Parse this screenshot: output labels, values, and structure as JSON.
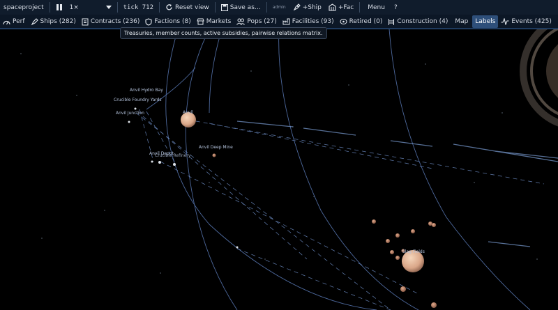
{
  "toolbar": {
    "app_name": "spaceproject",
    "speed": "1×",
    "tick": "tick 712",
    "reset_view": "Reset view",
    "save_as": "Save as…",
    "admin": "admin",
    "add_ship": "+Ship",
    "add_fac": "+Fac",
    "menu": "Menu",
    "help": "?"
  },
  "tabs": [
    {
      "label": "Perf"
    },
    {
      "label": "Ships (282)"
    },
    {
      "label": "Contracts (236)"
    },
    {
      "label": "Factions (8)"
    },
    {
      "label": "Markets"
    },
    {
      "label": "Pops (27)"
    },
    {
      "label": "Facilities (93)"
    },
    {
      "label": "Retired (0)"
    },
    {
      "label": "Construction (4)"
    },
    {
      "label": "Map"
    },
    {
      "label": "Labels"
    },
    {
      "label": "Events (425)"
    }
  ],
  "tooltip": "Treasuries, member counts, active subsidies, pairwise relations matrix.",
  "map_labels": {
    "anvil_hydro_bay": "Anvil Hydro Bay",
    "crucible_foundry": "Crucible Foundry Yards",
    "anvil_junction": "Anvil Junction",
    "anvil": "Anvil",
    "anvil_deep_mine": "Anvil Deep Mine",
    "anvil_depot": "Anvil Depot",
    "overlap": "Crucible Refinery",
    "slag_fields": "Slag Fields"
  },
  "icons": {
    "pause": "pause-icon",
    "dropdown": "chevron-down-icon",
    "reset": "refresh-icon",
    "save": "save-icon",
    "ship": "rocket-icon",
    "fac": "building-icon",
    "perf": "gauge-icon",
    "ships": "rocket-icon",
    "contracts": "contract-icon",
    "factions": "shield-icon",
    "markets": "store-icon",
    "pops": "people-icon",
    "facilities": "factory-icon",
    "retired": "retired-icon",
    "construction": "construction-icon",
    "events": "pulse-icon"
  },
  "colors": {
    "toolbar_bg": "#101c2c",
    "tab_active": "#2e4f7a",
    "space": "#000000",
    "orbit": "#5b7bb8",
    "planet": "#e8b898"
  }
}
